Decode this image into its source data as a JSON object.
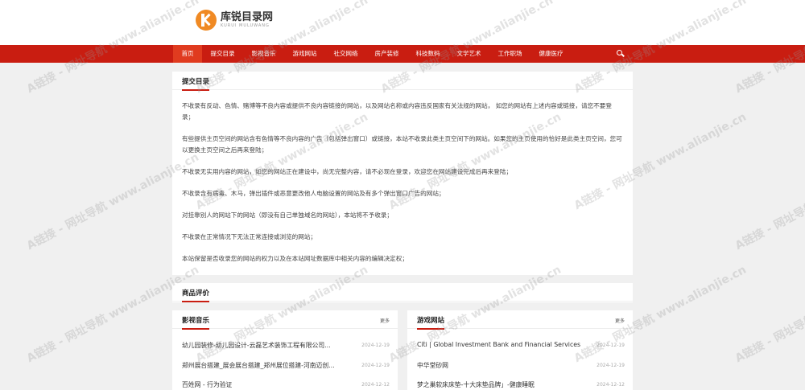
{
  "header": {
    "logo_cn": "库锐目录网",
    "logo_en": "KURUI MULUWANG"
  },
  "nav": {
    "items": [
      "首页",
      "提交目录",
      "影视音乐",
      "游戏网站",
      "社交网络",
      "房产装修",
      "科技数码",
      "文学艺术",
      "工作职场",
      "健康医疗"
    ],
    "active_index": 0,
    "search_icon": "search-icon"
  },
  "submit": {
    "title": "提交目录",
    "paragraphs": [
      "不收录有反动、色情、赌博等不良内容或提供不良内容链接的网站，以及网站名称或内容违反国家有关法规的网站， 如您的网站有上述内容或链接，请您不要登录；",
      "有些提供主页空间的网站含有色情等不良内容的广告（包括弹出窗口）或链接，本站不收录此类主页空间下的网站。如果您的主页使用的恰好是此类主页空间，您可以更换主页空间之后再来登陆；",
      "不收录无实用内容的网站，如您的网站正在建设中，尚无完整内容，请不必现在登录，欢迎您在网站建设完成后再来登陆；",
      "不收录含有病毒、木马，弹出插件或恶意更改他人电脑设置的网站及有多个弹出窗口广告的网站；",
      "对挂靠别人的网站下的网站（即没有自己单独域名的网站），本站将不予收录；",
      "不收录在正常情况下无法正常连接或浏览的网站；",
      "本站保留是否收录您的网站的权力以及在本站网址数据库中相关内容的编辑决定权；"
    ]
  },
  "reviews": {
    "title": "商品评价"
  },
  "left_list": {
    "title": "影视音乐",
    "more": "更多",
    "rows": [
      {
        "text": "幼儿园装修-幼儿园设计-云磊艺术装饰工程有限公司...",
        "date": "2024-12-19"
      },
      {
        "text": "郑州展台搭建_展会展台搭建_郑州展位搭建-河南迈创...",
        "date": "2024-12-19"
      },
      {
        "text": "百姓网 - 行为验证",
        "date": "2024-12-12"
      }
    ]
  },
  "right_list": {
    "title": "游戏网站",
    "more": "更多",
    "rows": [
      {
        "text": "Citi | Global Investment Bank and Financial Services",
        "date": "2024-12-19"
      },
      {
        "text": "中华堂砂网",
        "date": "2024-12-19"
      },
      {
        "text": "梦之巢软床床垫-十大床垫品牌」-健康睡眠",
        "date": "2024-12-12"
      }
    ]
  },
  "watermark": "A链接 - 网址导航 www.alianjie.cn"
}
